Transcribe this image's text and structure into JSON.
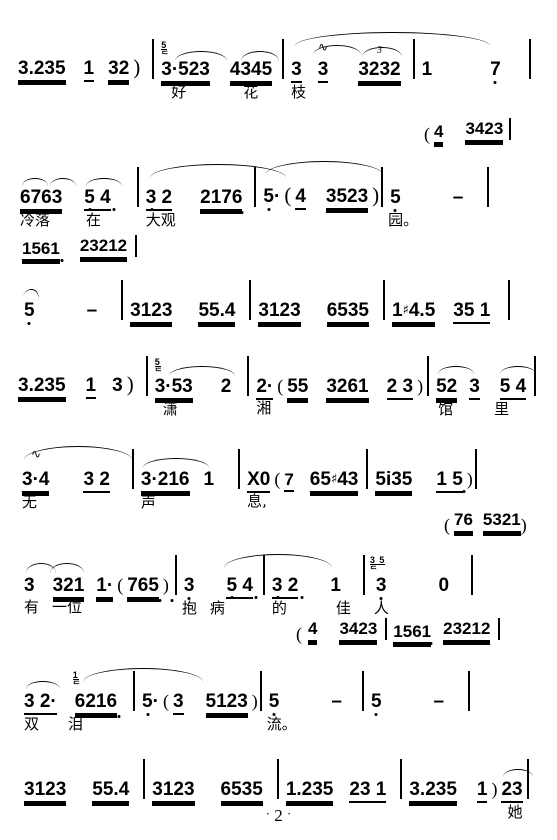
{
  "document": {
    "type": "jianpu-numbered-musical-notation",
    "script": "chinese",
    "page_number": "2",
    "page_number_decor": "·"
  },
  "lyrics_full": "好花枝冷落在大观园。潇湘馆里无声息,有一位抱病的佳人双泪流。她",
  "symbols": {
    "barline": "|",
    "open_paren": "(",
    "close_paren": ")",
    "sharp": "♯",
    "mordent": "∿",
    "triplet": "3",
    "rest": "0",
    "percussion": "X",
    "dash": "–"
  },
  "systems": [
    {
      "id": "system-1",
      "measures": [
        {
          "id": "m1-pickup",
          "notes": "3.235  1  32 )"
        },
        {
          "id": "m1-1",
          "grace": "5",
          "notes": "3·523  4345",
          "lyrics": [
            "好",
            "花"
          ]
        },
        {
          "id": "m1-2",
          "notes": "3  3  3232",
          "lyrics": [
            "枝"
          ],
          "ornaments": [
            "mordent",
            "triplet-3"
          ]
        },
        {
          "id": "m1-3",
          "notes": "1      7"
        }
      ]
    },
    {
      "id": "system-2",
      "upper_line": "( 4    3423",
      "measures": [
        {
          "id": "m2-0",
          "notes": "6763  5 4",
          "lyrics": [
            "冷落",
            "在"
          ]
        },
        {
          "id": "m2-1",
          "notes": "3 2   2176",
          "lyrics": [
            "大观"
          ]
        },
        {
          "id": "m2-2",
          "notes": "5·( 4  3523 )"
        },
        {
          "id": "m2-3",
          "notes": "5      –",
          "lyrics": [
            "园。"
          ]
        }
      ]
    },
    {
      "id": "system-3",
      "upper_line": "1561  23212",
      "measures": [
        {
          "id": "m3-0",
          "notes": "5      –"
        },
        {
          "id": "m3-1",
          "notes": "3123   55·4"
        },
        {
          "id": "m3-2",
          "notes": "3123   6535"
        },
        {
          "id": "m3-3",
          "notes": "1♯4·5  35 1"
        }
      ]
    },
    {
      "id": "system-4",
      "measures": [
        {
          "id": "m4-0",
          "notes": "3.235  1  3 )"
        },
        {
          "id": "m4-1",
          "grace": "5",
          "notes": "3·53   2",
          "lyrics": [
            "潇"
          ]
        },
        {
          "id": "m4-2",
          "notes": "2·( 55  3261  2 3 )",
          "lyrics": [
            "湘"
          ]
        },
        {
          "id": "m4-3",
          "notes": "52 3  5 4",
          "lyrics": [
            "馆",
            "里"
          ]
        }
      ]
    },
    {
      "id": "system-5",
      "measures": [
        {
          "id": "m5-0",
          "notes": "3·4   3 2",
          "lyrics": [
            "无"
          ],
          "ornaments": [
            "mordent"
          ]
        },
        {
          "id": "m5-1",
          "notes": "3·216  1",
          "lyrics": [
            "声"
          ]
        },
        {
          "id": "m5-2",
          "notes": "X0( 7  65♯43",
          "lyrics": [
            "息,"
          ]
        },
        {
          "id": "m5-3",
          "notes": "5i35   1  5 )"
        }
      ]
    },
    {
      "id": "system-6",
      "upper_line": "( 76  5321 )",
      "measures": [
        {
          "id": "m6-0",
          "notes": "3  321  1·( 765 )",
          "lyrics": [
            "有",
            "一位"
          ]
        },
        {
          "id": "m6-1",
          "notes": "3   5 4",
          "lyrics": [
            "抱",
            "病"
          ]
        },
        {
          "id": "m6-2",
          "notes": "3 2   1",
          "lyrics": [
            "的",
            "佳"
          ]
        },
        {
          "id": "m6-3",
          "grace": "35",
          "notes": "3     0",
          "lyrics": [
            "人"
          ]
        }
      ]
    },
    {
      "id": "system-7",
      "upper_line": "( 4   3423  |  1561  23212",
      "measures": [
        {
          "id": "m7-0",
          "notes": "3 2·",
          "grace": "1",
          "notes2": "6216",
          "lyrics": [
            "双",
            "泪"
          ]
        },
        {
          "id": "m7-1",
          "notes": "5·( 3  5123 )"
        },
        {
          "id": "m7-2",
          "notes": "5      –",
          "lyrics": [
            "流。"
          ]
        },
        {
          "id": "m7-3",
          "notes": "5      –"
        }
      ]
    },
    {
      "id": "system-8",
      "measures": [
        {
          "id": "m8-0",
          "notes": "3123   55·4"
        },
        {
          "id": "m8-1",
          "notes": "3123   6535"
        },
        {
          "id": "m8-2",
          "notes": "1·235  23 1"
        },
        {
          "id": "m8-3",
          "notes": "3.235  1 )23",
          "lyrics": [
            "她"
          ]
        }
      ]
    }
  ]
}
